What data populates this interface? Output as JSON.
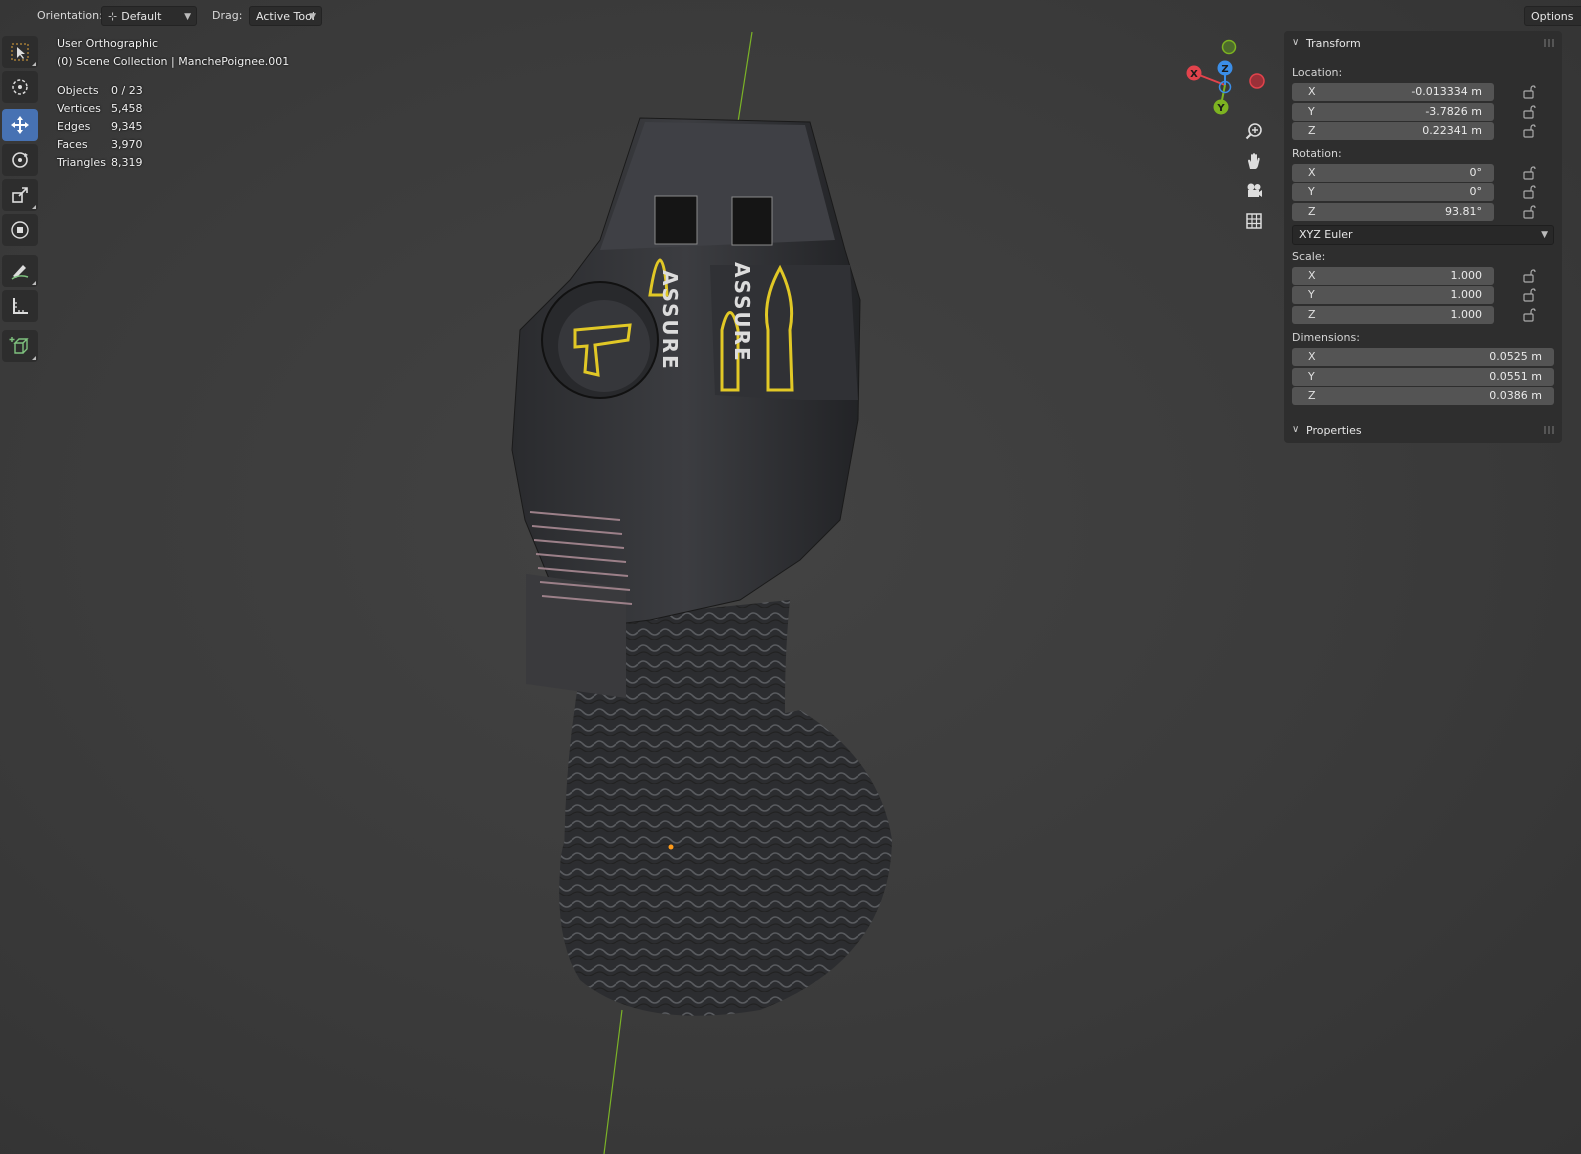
{
  "header": {
    "orientation_label": "Orientation:",
    "orientation_value": "Default",
    "drag_label": "Drag:",
    "drag_value": "Active Tool",
    "options_label": "Options"
  },
  "toolbar": {
    "tools": [
      "select-box",
      "cursor",
      "move",
      "rotate",
      "scale",
      "transform",
      "annotate",
      "measure",
      "add-cube"
    ],
    "active": "move"
  },
  "overlay": {
    "view_name": "User Orthographic",
    "collection": "(0) Scene Collection | MancheP oignee.001",
    "stats": [
      {
        "label": "Objects",
        "value": "0 / 23"
      },
      {
        "label": "Vertices",
        "value": "5,458"
      },
      {
        "label": "Edges",
        "value": "9,345"
      },
      {
        "label": "Faces",
        "value": "3,970"
      },
      {
        "label": "Triangles",
        "value": "8,319"
      }
    ]
  },
  "gizmo": {
    "x_label": "X",
    "y_label": "Y",
    "z_label": "Z",
    "colors": {
      "x": "#e2434c",
      "y": "#7db321",
      "z": "#3b8ee8"
    }
  },
  "nav_buttons": [
    "zoom-icon",
    "hand-pan-icon",
    "camera-icon",
    "grid-icon"
  ],
  "panel": {
    "transform_title": "Transform",
    "location_label": "Location:",
    "location": [
      {
        "axis": "X",
        "value": "-0.013334 m"
      },
      {
        "axis": "Y",
        "value": "-3.7826 m"
      },
      {
        "axis": "Z",
        "value": "0.22341 m"
      }
    ],
    "rotation_label": "Rotation:",
    "rotation": [
      {
        "axis": "X",
        "value": "0°"
      },
      {
        "axis": "Y",
        "value": "0°"
      },
      {
        "axis": "Z",
        "value": "93.81°"
      }
    ],
    "rotation_mode": "XYZ Euler",
    "scale_label": "Scale:",
    "scale": [
      {
        "axis": "X",
        "value": "1.000"
      },
      {
        "axis": "Y",
        "value": "1.000"
      },
      {
        "axis": "Z",
        "value": "1.000"
      }
    ],
    "dimensions_label": "Dimensions:",
    "dimensions": [
      {
        "axis": "X",
        "value": "0.0525 m"
      },
      {
        "axis": "Y",
        "value": "0.0551 m"
      },
      {
        "axis": "Z",
        "value": "0.0386 m"
      }
    ],
    "properties_title": "Properties"
  },
  "model": {
    "decal_text": "ASSURE",
    "decal_color": "#e1c826"
  }
}
